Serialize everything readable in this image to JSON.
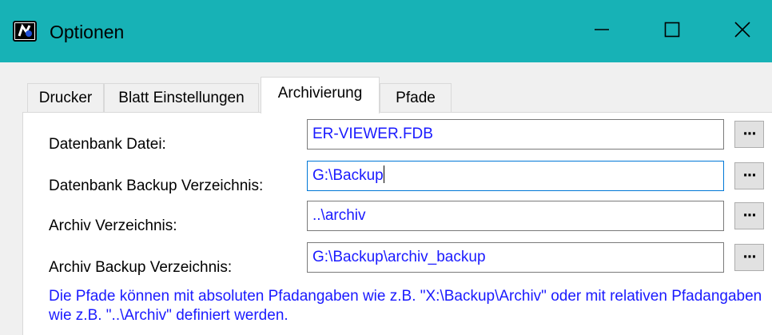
{
  "window": {
    "title": "Optionen",
    "icon": "app-icon",
    "controls": {
      "minimize": "minimize-icon",
      "maximize": "maximize-icon",
      "close": "close-icon"
    }
  },
  "tabs": [
    {
      "label": "Drucker",
      "selected": false
    },
    {
      "label": "Blatt Einstellungen",
      "selected": false
    },
    {
      "label": "Archivierung",
      "selected": true
    },
    {
      "label": "Pfade",
      "selected": false
    }
  ],
  "form": {
    "rows": [
      {
        "label": "Datenbank Datei:",
        "value": "ER-VIEWER.FDB",
        "button": "···"
      },
      {
        "label": "Datenbank Backup Verzeichnis:",
        "value": "G:\\Backup",
        "button": "···",
        "focused": true
      },
      {
        "label": "Archiv Verzeichnis:",
        "value": "..\\archiv",
        "button": "···"
      },
      {
        "label": "Archiv Backup Verzeichnis:",
        "value": "G:\\Backup\\archiv_backup",
        "button": "···"
      }
    ],
    "hint": "Die Pfade können mit absoluten Pfadangaben wie z.B. \"X:\\Backup\\Archiv\" oder mit relativen Pfadangaben wie z.B. \"..\\Archiv\" definiert werden."
  },
  "colors": {
    "titlebar": "#17b2b6",
    "value_text": "#1a1aff",
    "focus_border": "#0078d7",
    "panel_background": "#ffffff",
    "window_background": "#f0f0f0"
  }
}
